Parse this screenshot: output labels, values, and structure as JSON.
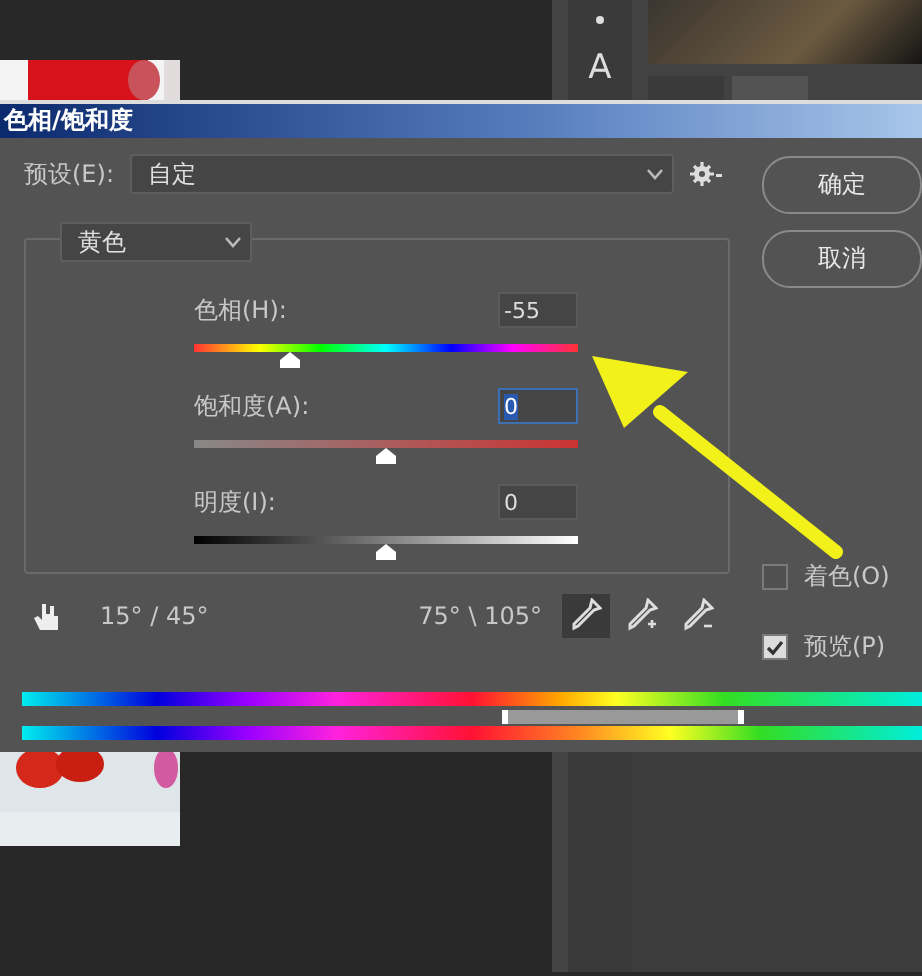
{
  "toolbar": {
    "tool_label": "A"
  },
  "dialog": {
    "title": "色相/饱和度",
    "preset_label": "预设(E):",
    "preset_value": "自定",
    "buttons": [
      "确定",
      "取消"
    ],
    "channel": "黄色",
    "sliders": [
      {
        "kind": "hue",
        "label": "色相(H):",
        "value": "-55",
        "level": 0.25,
        "focused": false
      },
      {
        "kind": "saturation",
        "label": "饱和度(A):",
        "value": "0",
        "level": 0.5,
        "focused": true
      },
      {
        "kind": "lightness",
        "label": "明度(I):",
        "value": "0",
        "level": 0.5,
        "focused": false
      }
    ],
    "colorize": {
      "label": "着色(O)",
      "checked": false
    },
    "range_left": "15° / 45°",
    "range_right": "75° \\ 105°",
    "eyedroppers": [
      {
        "kind": "sample",
        "selected": true
      },
      {
        "kind": "add",
        "selected": false
      },
      {
        "kind": "subtract",
        "selected": false
      }
    ],
    "preview": {
      "label": "预览(P)",
      "checked": true
    }
  }
}
